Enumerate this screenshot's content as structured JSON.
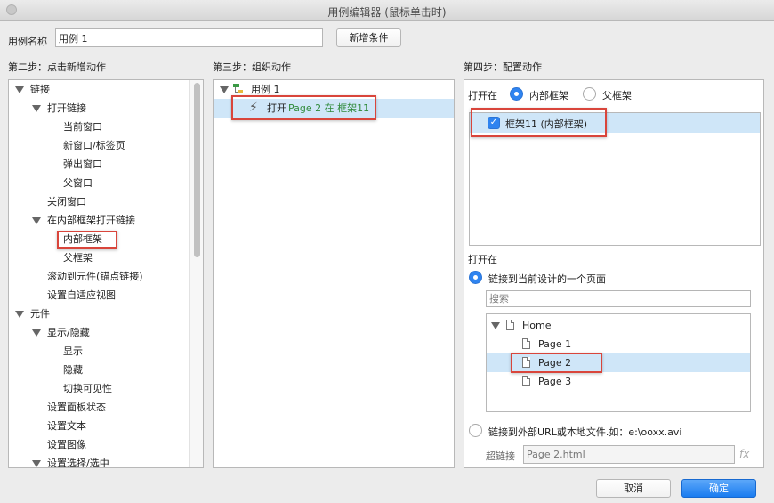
{
  "window": {
    "title": "用例编辑器 (鼠标单击时)"
  },
  "case_name": {
    "label": "用例名称",
    "value": "用例 1",
    "add_condition_button": "新增条件"
  },
  "step2": {
    "title": "第二步：点击新增动作",
    "tree": [
      {
        "label": "链接",
        "level": 0,
        "expanded": true
      },
      {
        "label": "打开链接",
        "level": 1,
        "expanded": true
      },
      {
        "label": "当前窗口",
        "level": 2
      },
      {
        "label": "新窗口/标签页",
        "level": 2
      },
      {
        "label": "弹出窗口",
        "level": 2
      },
      {
        "label": "父窗口",
        "level": 2
      },
      {
        "label": "关闭窗口",
        "level": 1
      },
      {
        "label": "在内部框架打开链接",
        "level": 1,
        "expanded": true
      },
      {
        "label": "内部框架",
        "level": 2,
        "highlighted": true
      },
      {
        "label": "父框架",
        "level": 2
      },
      {
        "label": "滚动到元件(锚点链接)",
        "level": 1
      },
      {
        "label": "设置自适应视图",
        "level": 1
      },
      {
        "label": "元件",
        "level": 0,
        "expanded": true
      },
      {
        "label": "显示/隐藏",
        "level": 1,
        "expanded": true
      },
      {
        "label": "显示",
        "level": 2
      },
      {
        "label": "隐藏",
        "level": 2
      },
      {
        "label": "切换可见性",
        "level": 2
      },
      {
        "label": "设置面板状态",
        "level": 1
      },
      {
        "label": "设置文本",
        "level": 1
      },
      {
        "label": "设置图像",
        "level": 1
      },
      {
        "label": "设置选择/选中",
        "level": 1,
        "expanded": true
      }
    ]
  },
  "step3": {
    "title": "第三步：组织动作",
    "case_label": "用例 1",
    "action": {
      "verb": "打开",
      "detail": "Page 2 在 框架11"
    }
  },
  "step4": {
    "title": "第四步：配置动作",
    "open_in_label": "打开在",
    "radio_inline_frame": "内部框架",
    "radio_parent_frame": "父框架",
    "frame_item": "框架11 (内部框架)",
    "open_in_label2": "打开在",
    "link_current_design": "链接到当前设计的一个页面",
    "search_placeholder": "搜索",
    "pages": [
      {
        "label": "Home",
        "level": 0
      },
      {
        "label": "Page 1",
        "level": 1
      },
      {
        "label": "Page 2",
        "level": 1,
        "selected": true
      },
      {
        "label": "Page 3",
        "level": 1
      }
    ],
    "link_external": "链接到外部URL或本地文件.如：e:\\ooxx.avi",
    "hyperlink_label": "超链接",
    "hyperlink_value": "Page 2.html",
    "fx_label": "fx"
  },
  "footer": {
    "cancel": "取消",
    "ok": "确定"
  },
  "colors": {
    "accent": "#2f84f0",
    "highlight_border": "#d9453b",
    "selection": "#cfe6f8",
    "action_text": "#2f8a3a"
  }
}
